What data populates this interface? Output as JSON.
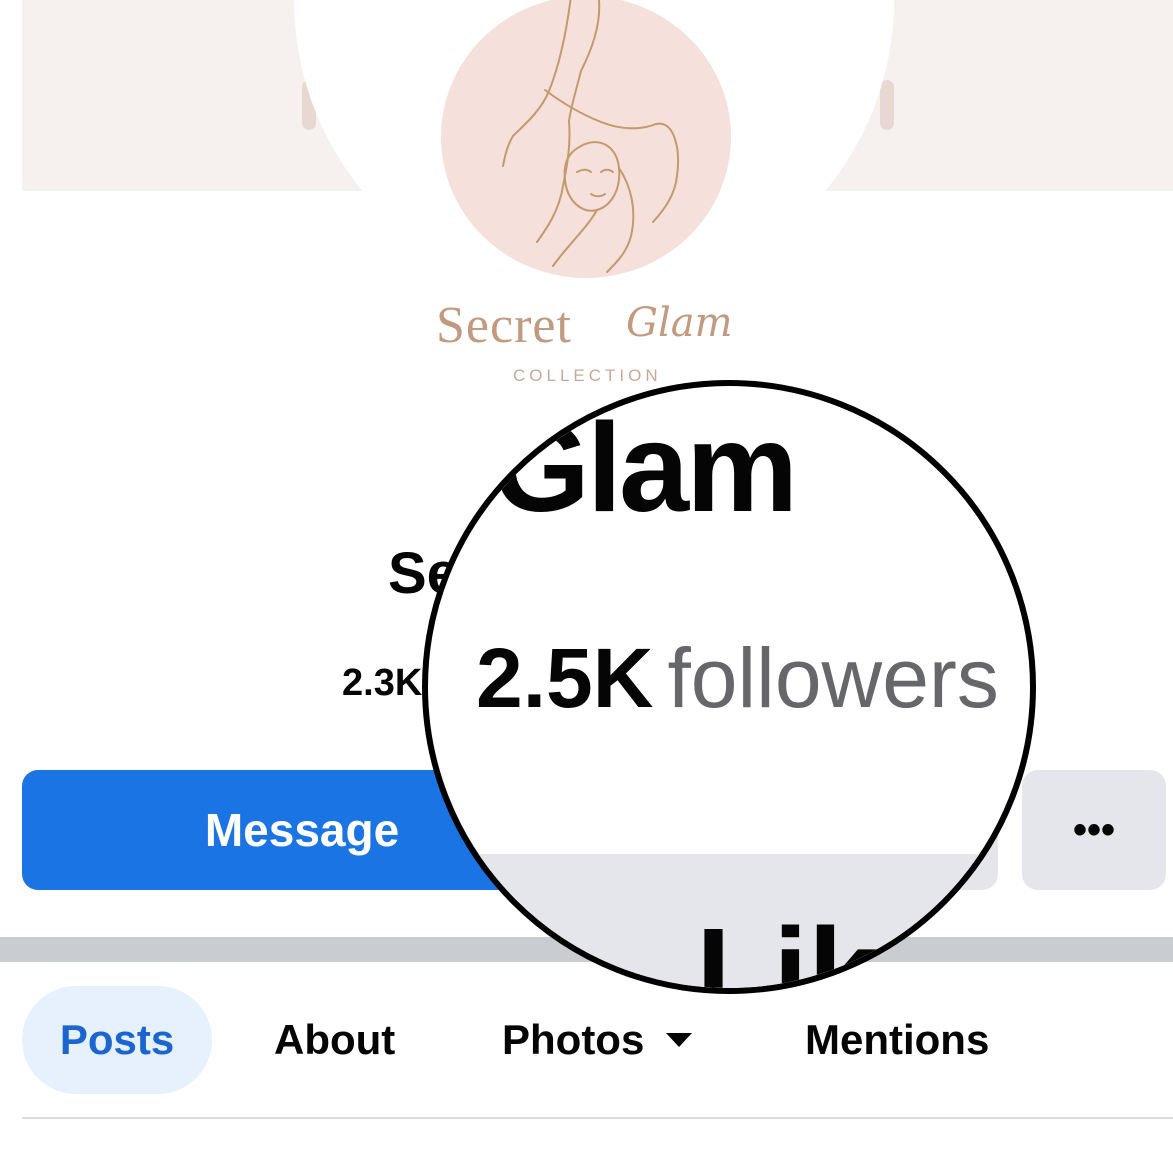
{
  "brand": {
    "name": "Secret",
    "script": "Glam",
    "subtitle": "COLLECTION"
  },
  "page": {
    "name_visible": "Se",
    "followers_small_visible": "2.3K"
  },
  "magnifier": {
    "name_fragment": "Glam",
    "followers_count": "2.5K",
    "followers_label": "followers",
    "like_fragment": "Lik"
  },
  "actions": {
    "message_label": "Message",
    "more_label": "•••"
  },
  "tabs": [
    {
      "label": "Posts",
      "active": true
    },
    {
      "label": "About",
      "active": false
    },
    {
      "label": "Photos",
      "active": false,
      "has_dropdown": true
    },
    {
      "label": "Mentions",
      "active": false
    }
  ],
  "colors": {
    "primary": "#1b74e4",
    "secondary_button": "#e4e6eb",
    "active_tab_bg": "#e7f0fd",
    "active_tab_text": "#1b65d0",
    "logo_accent": "#c29a7f",
    "cover_bg": "#f6f1ee"
  },
  "icons": {
    "photos_dropdown": "chevron-down-icon",
    "more": "more-horizontal-icon"
  }
}
